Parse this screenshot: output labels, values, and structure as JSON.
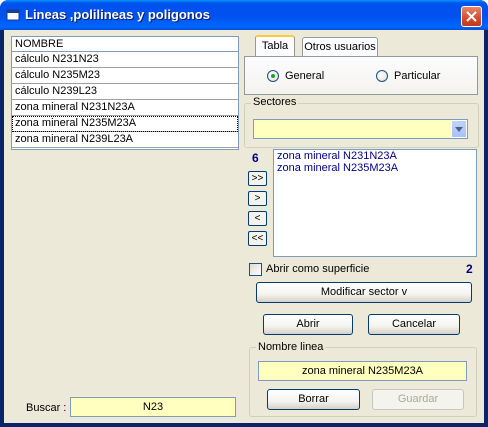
{
  "window": {
    "title": "Lineas ,polilineas y poligonos"
  },
  "list": {
    "header": "NOMBRE",
    "rows": [
      "cálculo N231N23",
      "cálculo N235M23",
      "cálculo N239L23",
      "zona mineral N231N23A",
      "zona mineral N235M23A",
      "zona mineral N239L23A"
    ]
  },
  "search": {
    "label": "Buscar :",
    "value": "N23"
  },
  "tabs": [
    {
      "label": "Tabla"
    },
    {
      "label": "Otros usuarios"
    }
  ],
  "radios": {
    "general": "General",
    "particular": "Particular",
    "selected": "General"
  },
  "sectores": {
    "title": "Sectores",
    "value": ""
  },
  "available_count": "6",
  "transfer_buttons": [
    ">>",
    ">",
    "<",
    "<<"
  ],
  "selected_list": [
    "zona mineral N231N23A",
    "zona mineral N235M23A"
  ],
  "surface": {
    "label": "Abrir como superficie",
    "checked": false,
    "selected_count": "2"
  },
  "buttons": {
    "modificar": "Modificar sector    v",
    "abrir": "Abrir",
    "cancelar": "Cancelar",
    "borrar": "Borrar",
    "guardar": "Guardar"
  },
  "nombre_linea": {
    "title": "Nombre linea",
    "value": "zona mineral N235M23A"
  },
  "colors": {
    "input_bg": "#ffffc0",
    "dialog_bg": "#ece9d8",
    "titlebar": "#0054e3"
  }
}
